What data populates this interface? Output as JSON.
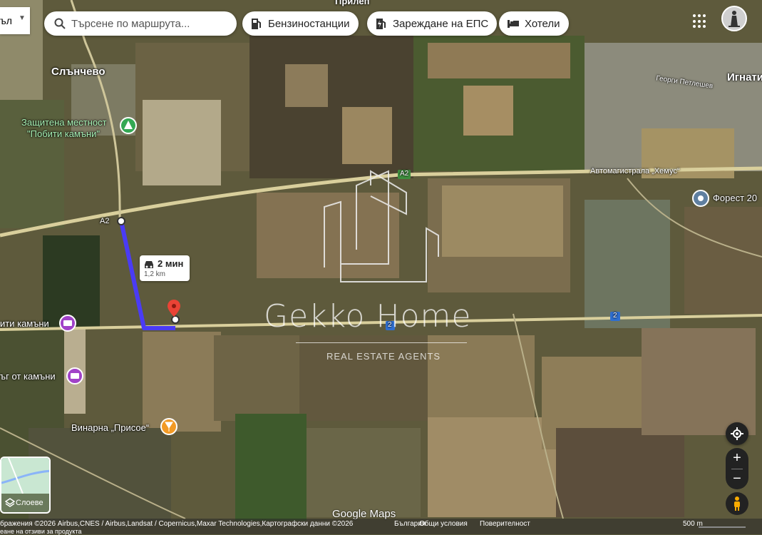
{
  "toolbar": {
    "layers_left_label": "ъл",
    "search_placeholder": "Търсене по маршрута...",
    "chips": [
      "Бензиностанции",
      "Зареждане на ЕПС",
      "Хотели"
    ]
  },
  "map_labels": {
    "town_slanchevo": "Слънчево",
    "protected_area_line1": "Защитена местност",
    "protected_area_line2": "\"Побити камъни\"",
    "highway_name": "Автомагистрала „Хемус“",
    "forest": "Форест 20",
    "ignatievo": "Игнати",
    "street": "Георги Петлешев",
    "pobiti_left": "ити камъни",
    "kamani_left": "ъг от камъни",
    "winery": "Винарна „Присое“",
    "town_top": "Прилеп",
    "shield_a2_left": "A2",
    "shield_a2_center": "A2",
    "shield_2": "2",
    "shield_2_center": "2"
  },
  "route": {
    "time": "2 мин",
    "distance": "1,2 km"
  },
  "watermark": {
    "brand": "Gekko Home",
    "tagline": "REAL ESTATE AGENTS"
  },
  "layers_button_label": "Слоеве",
  "google_logo": "Google Maps",
  "footer": {
    "attribution": "бражения ©2026 Airbus,CNES / Airbus,Landsat / Copernicus,Maxar Technologies,Картографски данни ©2026",
    "country": "България",
    "terms": "Общи условия",
    "privacy": "Поверителност",
    "scale": "500 m",
    "feedback": "еане на отзиви за продукта"
  },
  "colors": {
    "route": "#4a3bf5",
    "pin_red": "#ea4335",
    "poi_purple": "#a142c8",
    "poi_green": "#34a853",
    "poi_orange": "#f29a25",
    "pegman": "#f9ab00"
  }
}
